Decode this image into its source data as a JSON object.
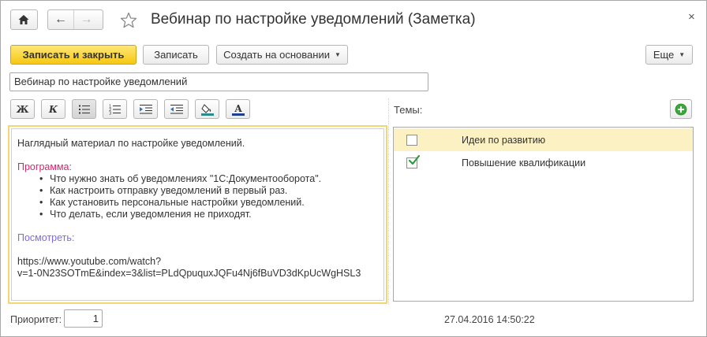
{
  "window": {
    "title": "Вебинар по настройке уведомлений (Заметка)",
    "close_glyph": "×",
    "home_icon": "home-icon",
    "back_glyph": "←",
    "forward_glyph": "→"
  },
  "toolbar": {
    "save_close_label": "Записать и закрыть",
    "save_label": "Записать",
    "create_based_label": "Создать на основании",
    "more_label": "Еще"
  },
  "name_field": {
    "value": "Вебинар по настройке уведомлений"
  },
  "format_toolbar": {
    "bold": "Ж",
    "italic": "К",
    "buttons": [
      "bold-icon",
      "italic-icon",
      "bulleted-list-icon",
      "numbered-list-icon",
      "indent-increase-icon",
      "indent-decrease-icon",
      "fill-color-icon",
      "font-color-icon"
    ]
  },
  "editor": {
    "intro": "Наглядный материал по настройке уведомлений.",
    "program_heading": "Программа:",
    "program_items": [
      "Что нужно знать об уведомлениях \"1С:Документооборота\".",
      "Как настроить отправку уведомлений в первый раз.",
      "Как установить персональные настройки уведомлений.",
      "Что делать, если уведомления не приходят."
    ],
    "watch_heading": "Посмотреть:",
    "url_line1": "https://www.youtube.com/watch?",
    "url_line2": "v=1-0N23SOTmE&index=3&list=PLdQpuquxJQFu4Nj6fBuVD3dKpUcWgHSL3"
  },
  "topics": {
    "label": "Темы:",
    "items": [
      {
        "label": "Идеи по развитию",
        "checked": false,
        "selected": true
      },
      {
        "label": "Повышение квалификации",
        "checked": true,
        "selected": false
      }
    ]
  },
  "footer": {
    "priority_label": "Приоритет:",
    "priority_value": "1",
    "timestamp": "27.04.2016 14:50:22"
  },
  "colors": {
    "primary_button": "#f6c812",
    "program_heading": "#e0206e",
    "watch_heading": "#7b6be6",
    "selected_row": "#fbf1c2",
    "check": "#2a9d3a",
    "add_icon": "#3aa83a"
  }
}
